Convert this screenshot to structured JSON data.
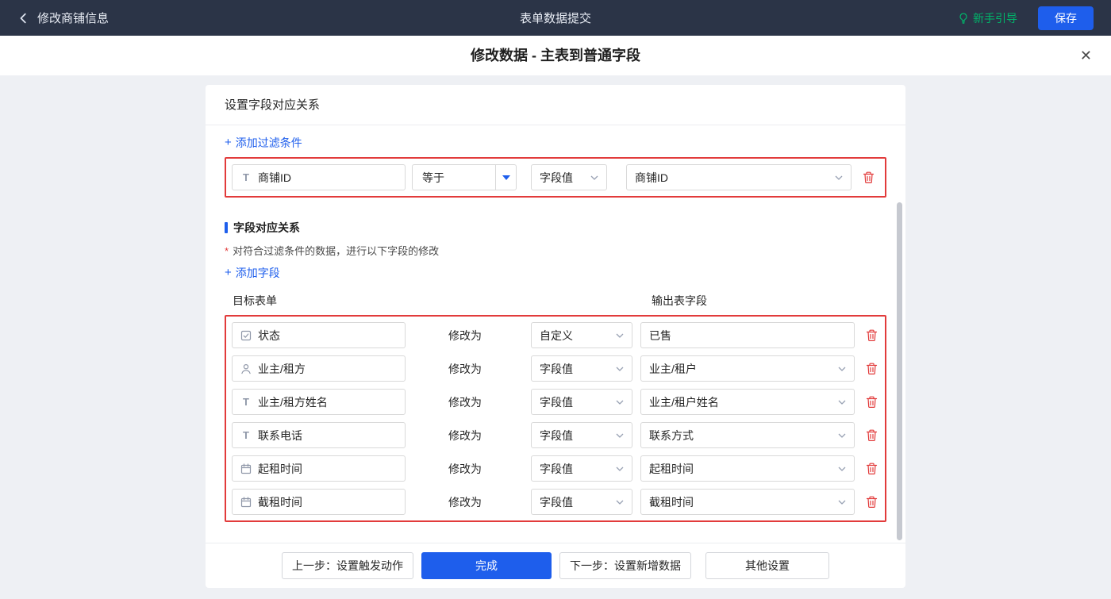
{
  "colors": {
    "accent": "#1e5eec",
    "green": "#00b56a",
    "danger": "#e23b3b",
    "topbar_bg": "#2b3447"
  },
  "icons": {
    "text": "T",
    "plus": "+"
  },
  "topbar": {
    "back_label": "修改商铺信息",
    "title": "表单数据提交",
    "guide_label": "新手引导",
    "save_label": "保存"
  },
  "dialog": {
    "title": "修改数据 - 主表到普通字段",
    "close_icon": "✕"
  },
  "panel": {
    "header": "设置字段对应关系",
    "add_filter_label": "添加过滤条件",
    "filter": {
      "field": "商铺ID",
      "operator": "等于",
      "value_type": "字段值",
      "value": "商铺ID"
    },
    "mapping": {
      "title": "字段对应关系",
      "required_mark": "*",
      "description": "对符合过滤条件的数据，进行以下字段的修改",
      "add_field_label": "添加字段",
      "col_target": "目标表单",
      "col_output": "输出表字段",
      "modify_label": "修改为",
      "rows": [
        {
          "icon": "select",
          "field": "状态",
          "type": "自定义",
          "value": "已售",
          "value_kind": "input"
        },
        {
          "icon": "person",
          "field": "业主/租方",
          "type": "字段值",
          "value": "业主/租户",
          "value_kind": "select"
        },
        {
          "icon": "text",
          "field": "业主/租方姓名",
          "type": "字段值",
          "value": "业主/租户姓名",
          "value_kind": "select"
        },
        {
          "icon": "text",
          "field": "联系电话",
          "type": "字段值",
          "value": "联系方式",
          "value_kind": "select"
        },
        {
          "icon": "calendar",
          "field": "起租时间",
          "type": "字段值",
          "value": "起租时间",
          "value_kind": "select"
        },
        {
          "icon": "calendar",
          "field": "截租时间",
          "type": "字段值",
          "value": "截租时间",
          "value_kind": "select"
        }
      ]
    },
    "footer": {
      "prev_label": "上一步：设置触发动作",
      "done_label": "完成",
      "next_label": "下一步：设置新增数据",
      "other_label": "其他设置"
    }
  }
}
